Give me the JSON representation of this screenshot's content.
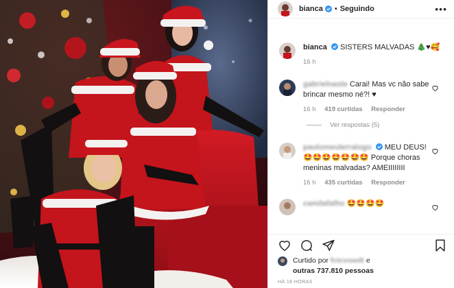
{
  "header": {
    "username": "bianca",
    "separator": "•",
    "follow_status": "Seguindo",
    "more_label": "•••"
  },
  "caption": {
    "username": "bianca",
    "text": "SISTERS MALVADAS 🎄♥🥰",
    "time": "16 h"
  },
  "comments": [
    {
      "username": "gabrielnaste",
      "text": "Carai! Mas vc não sabe brincar mesmo né?! ♥",
      "time": "16 h",
      "likes": "419 curtidas",
      "reply": "Responder",
      "view_replies": "Ver respostas (5)"
    },
    {
      "username": "paulomeuterralogo",
      "text": "MEU DEUS! 🤩🤩🤩🤩🤩🤩🤩 Porque choras meninas malvadas? AMEIIIIIIII",
      "time": "16 h",
      "likes": "435 curtidas",
      "reply": "Responder"
    },
    {
      "username": "camilafalho",
      "text": "🤩🤩🤩🤩",
      "time": "",
      "likes": "",
      "reply": ""
    }
  ],
  "likes_bar": {
    "prefix": "Curtido por",
    "liker": "fctcvowdt",
    "connector": "e",
    "others": "outras 737.810 pessoas"
  },
  "timestamp": "HÁ 16 HORAS",
  "icons": [
    "heart-icon",
    "comment-icon",
    "share-icon",
    "bookmark-icon",
    "verified-badge-icon",
    "more-options-icon"
  ],
  "colors": {
    "verified": "#3897f0",
    "muted": "#8e8e8e",
    "text": "#262626",
    "santa_red": "#c4141c"
  }
}
